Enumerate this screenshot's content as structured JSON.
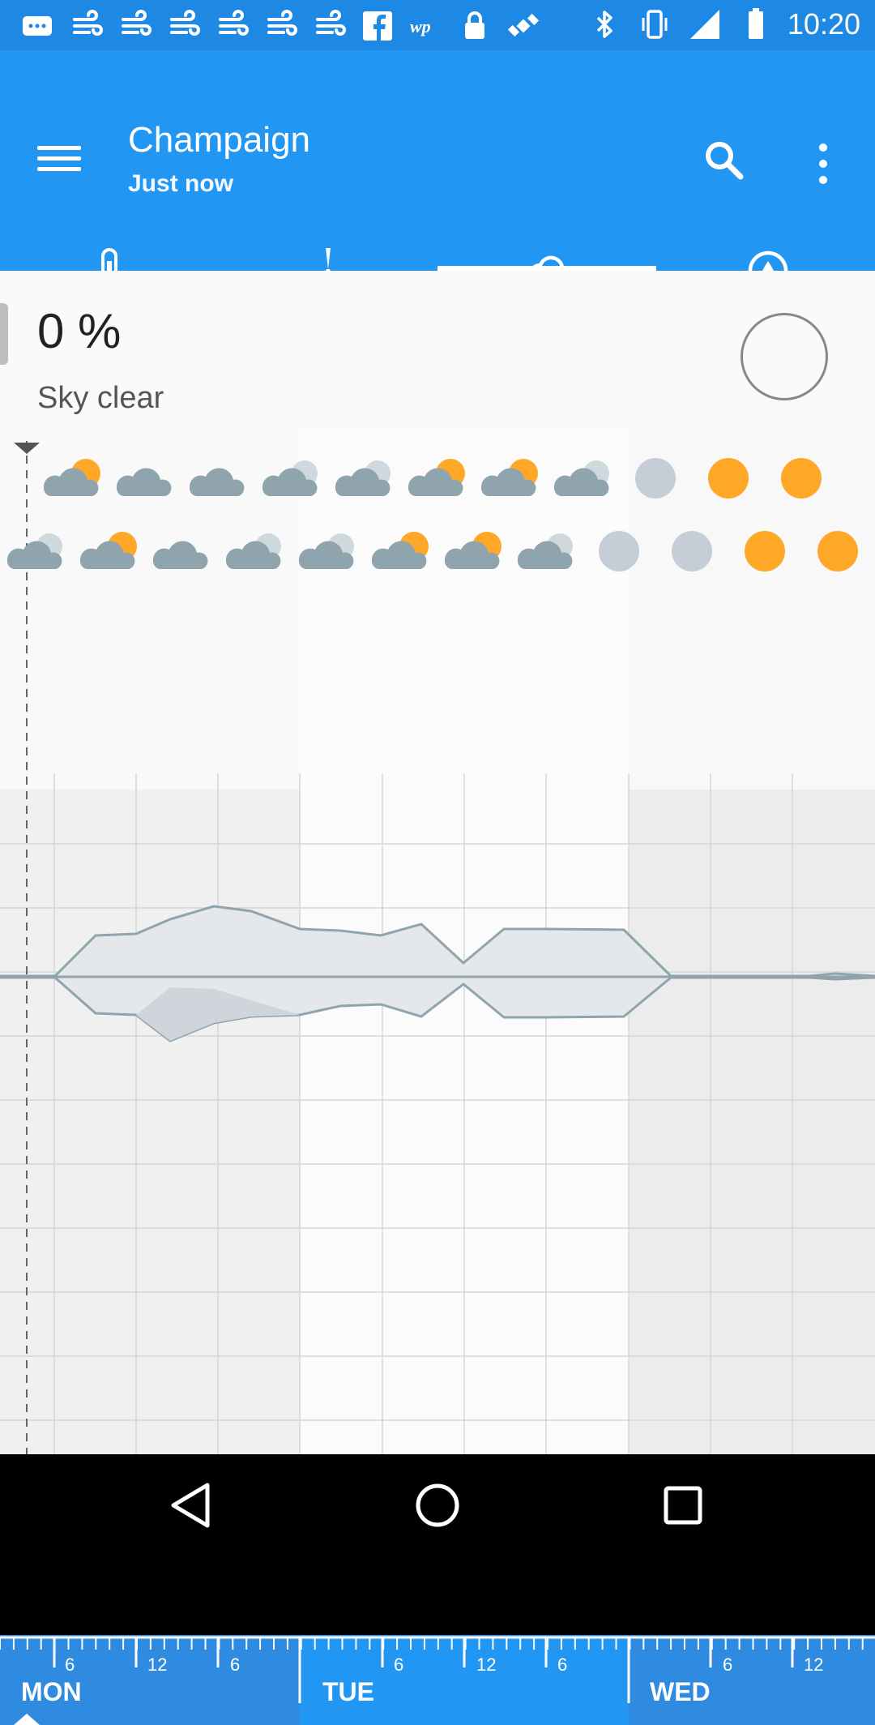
{
  "status_bar": {
    "time": "10:20",
    "icons": [
      "message-icon",
      "fan-icon",
      "fan-icon",
      "fan-icon",
      "fan-icon",
      "fan-icon",
      "fan-icon",
      "facebook-icon",
      "wp-icon",
      "lock-icon",
      "satellite-icon",
      "bluetooth-icon",
      "vibrate-icon",
      "signal-icon",
      "battery-icon"
    ]
  },
  "app_bar": {
    "title": "Champaign",
    "subtitle": "Just now",
    "colors": {
      "primary": "#2196F3",
      "status": "#1E88E5"
    }
  },
  "tabs": [
    {
      "name": "temperature",
      "icon": "thermometer-icon",
      "selected": false
    },
    {
      "name": "wind",
      "icon": "wind-turbine-icon",
      "selected": false
    },
    {
      "name": "cloud",
      "icon": "cloud-icon",
      "selected": true
    },
    {
      "name": "precipitation",
      "icon": "drop-icon",
      "selected": false
    }
  ],
  "summary": {
    "value": "0 %",
    "description": "Sky clear"
  },
  "forecast_icons": {
    "row1": [
      "partly-cloudy",
      "cloudy",
      "cloudy",
      "mostly-cloudy",
      "mostly-cloudy",
      "partly-cloudy",
      "partly-cloudy",
      "mostly-cloudy",
      "moon",
      "sun",
      "sun"
    ],
    "row2": [
      "mostly-cloudy",
      "partly-cloudy",
      "cloudy",
      "mostly-cloudy",
      "mostly-cloudy",
      "partly-cloudy",
      "partly-cloudy",
      "mostly-cloudy",
      "moon",
      "moon",
      "sun",
      "sun"
    ]
  },
  "timeline": {
    "days": [
      "MON",
      "TUE",
      "WED"
    ],
    "ticks": [
      "6",
      "12",
      "6",
      "6",
      "12",
      "6",
      "6",
      "12"
    ]
  }
}
